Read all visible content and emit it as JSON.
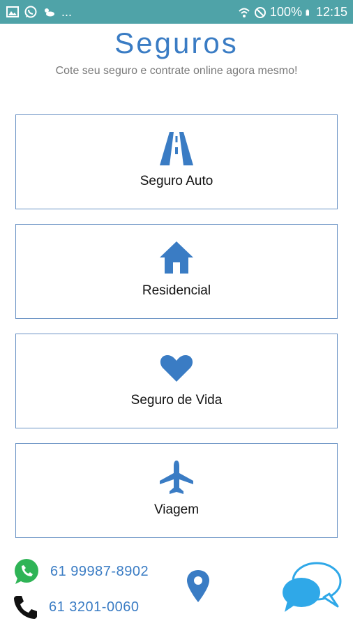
{
  "status_bar": {
    "left_icons": [
      "image-icon",
      "whatsapp-icon",
      "weather-icon"
    ],
    "more": "...",
    "battery": "100%",
    "time": "12:15"
  },
  "header": {
    "title": "Seguros",
    "subtitle": "Cote seu seguro e contrate online agora mesmo!"
  },
  "options": [
    {
      "label": "Seguro Auto",
      "icon": "road-icon"
    },
    {
      "label": "Residencial",
      "icon": "house-icon"
    },
    {
      "label": "Seguro de Vida",
      "icon": "heart-icon"
    },
    {
      "label": "Viagem",
      "icon": "airplane-icon"
    }
  ],
  "contacts": {
    "whatsapp": "61 99987-8902",
    "phone": "61 3201-0060"
  },
  "colors": {
    "accent": "#3a7cc4",
    "status_bar": "#4fa3a8",
    "whatsapp": "#2fb456",
    "chat": "#2fa8e8"
  }
}
